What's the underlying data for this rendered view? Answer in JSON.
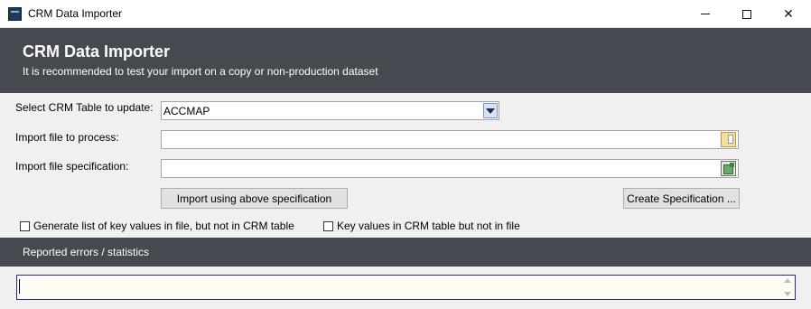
{
  "window": {
    "title": "CRM Data Importer",
    "icon": "app-icon",
    "controls": [
      "minimize-icon",
      "maximize-icon",
      "close-icon"
    ],
    "close_glyph": "✕"
  },
  "header": {
    "title": "CRM Data Importer",
    "subtitle": "It is recommended to test your import on a copy or non-production dataset",
    "background_color": "#454950"
  },
  "form": {
    "table_label": "Select CRM Table to update:",
    "table_value": "ACCMAP",
    "import_file_label": "Import file to process:",
    "import_file_value": "",
    "spec_label": "Import file specification:",
    "spec_value": "",
    "import_button": "Import using above specification",
    "create_spec_button": "Create Specification ...",
    "checkbox_key_values_in_file": {
      "label": "Generate list of key values in file, but not in CRM table",
      "checked": false
    },
    "checkbox_key_values_in_table": {
      "label": "Key values in CRM table but not in file",
      "checked": false
    }
  },
  "errors": {
    "title": "Reported errors / statistics",
    "log_text": "",
    "log_border_color": "#1f2f86"
  }
}
